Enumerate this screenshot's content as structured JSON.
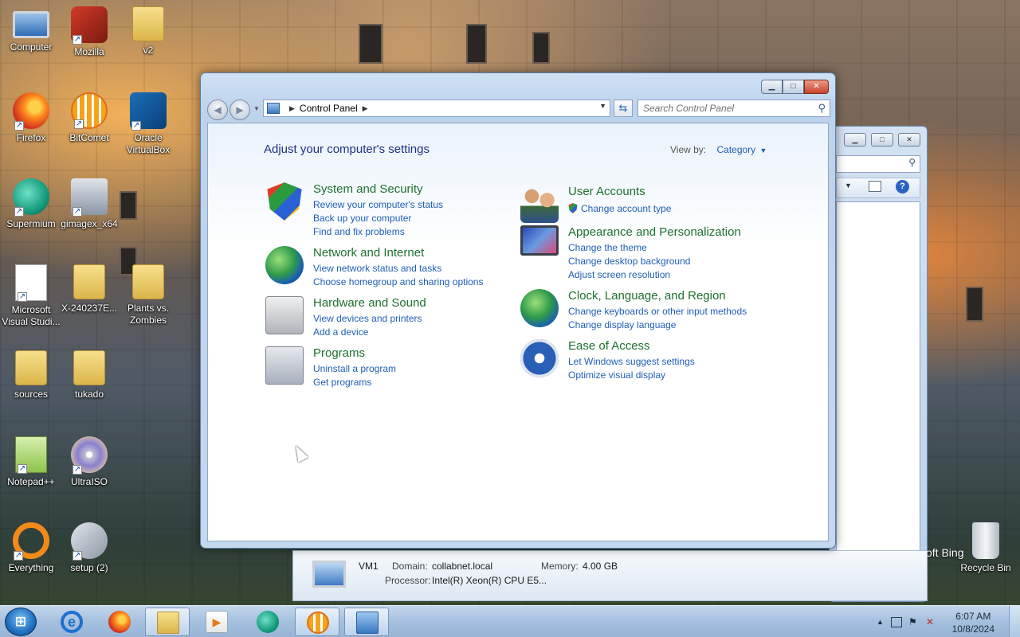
{
  "desktop": {
    "icons": [
      {
        "label": "Computer"
      },
      {
        "label": "Mozilla"
      },
      {
        "label": "v2"
      },
      {
        "label": "Firefox"
      },
      {
        "label": "BitComet"
      },
      {
        "label": "Oracle VirtualBox"
      },
      {
        "label": "Supermium"
      },
      {
        "label": "gimagex_x64"
      },
      {
        "label": "Microsoft Visual Studi..."
      },
      {
        "label": "X-240237E..."
      },
      {
        "label": "Plants vs. Zombies"
      },
      {
        "label": "sources"
      },
      {
        "label": "tukado"
      },
      {
        "label": "Notepad++"
      },
      {
        "label": "UltraISO"
      },
      {
        "label": "Everything"
      },
      {
        "label": "setup (2)"
      },
      {
        "label": "Recycle Bin"
      }
    ],
    "ms_bing_fragment": "oft Bing"
  },
  "window": {
    "address": {
      "root_label": "Control Panel"
    },
    "search_placeholder": "Search Control Panel",
    "heading": "Adjust your computer's settings",
    "view_by_label": "View by:",
    "view_by_value": "Category",
    "categories": [
      {
        "title": "System and Security",
        "icon": "shield-icon",
        "links": [
          "Review your computer's status",
          "Back up your computer",
          "Find and fix problems"
        ]
      },
      {
        "title": "Network and Internet",
        "icon": "globe-network-icon",
        "links": [
          "View network status and tasks",
          "Choose homegroup and sharing options"
        ]
      },
      {
        "title": "Hardware and Sound",
        "icon": "printer-icon",
        "links": [
          "View devices and printers",
          "Add a device"
        ]
      },
      {
        "title": "Programs",
        "icon": "programs-icon",
        "links": [
          "Uninstall a program",
          "Get programs"
        ]
      },
      {
        "title": "User Accounts",
        "icon": "users-icon",
        "links": [
          "Change account type"
        ]
      },
      {
        "title": "Appearance and Personalization",
        "icon": "monitor-icon",
        "links": [
          "Change the theme",
          "Change desktop background",
          "Adjust screen resolution"
        ]
      },
      {
        "title": "Clock, Language, and Region",
        "icon": "clock-globe-icon",
        "links": [
          "Change keyboards or other input methods",
          "Change display language"
        ]
      },
      {
        "title": "Ease of Access",
        "icon": "ease-of-access-icon",
        "links": [
          "Let Windows suggest settings",
          "Optimize visual display"
        ]
      }
    ]
  },
  "details": {
    "name": "VM1",
    "domain_label": "Domain:",
    "domain_value": "collabnet.local",
    "memory_label": "Memory:",
    "memory_value": "4.00 GB",
    "processor_label": "Processor:",
    "processor_value": "Intel(R) Xeon(R) CPU E5..."
  },
  "taskbar": {
    "items": [
      "start-orb",
      "internet-explorer",
      "firefox",
      "windows-explorer",
      "media-player",
      "supermium",
      "bitcomet",
      "control-panel"
    ],
    "active_item": "control-panel",
    "time": "6:07 AM",
    "date": "10/8/2024"
  }
}
